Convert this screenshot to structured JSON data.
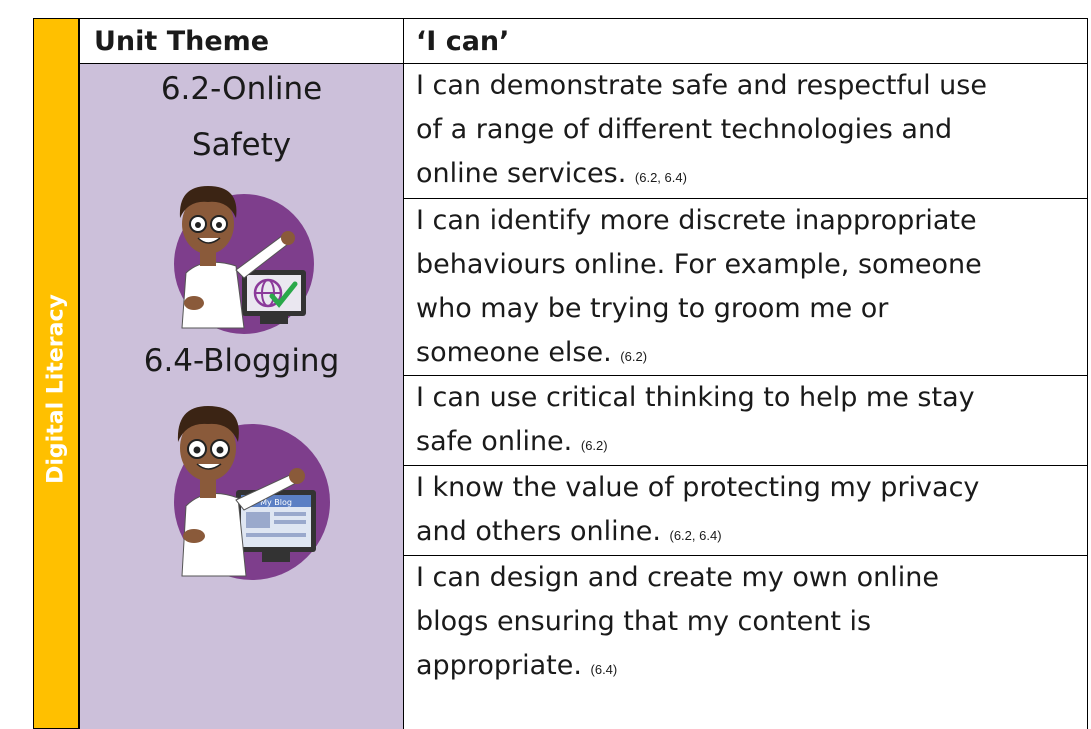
{
  "sidebar": {
    "label": "Digital Literacy",
    "color": "#ffc000"
  },
  "header": {
    "unit_theme": "Unit Theme",
    "i_can": "‘I can’"
  },
  "themes": [
    {
      "line1": "6.2-Online",
      "line2": "Safety",
      "icon": "teacher-globe-checkmark-icon"
    },
    {
      "line1": "6.4-Blogging",
      "icon": "teacher-blog-screen-icon",
      "screen_text": "My Blog"
    }
  ],
  "rows": [
    {
      "lines": [
        "I can demonstrate safe and respectful use",
        "of a range of different technologies and",
        "online services."
      ],
      "ref": "(6.2, 6.4)"
    },
    {
      "lines": [
        "I can identify more discrete inappropriate",
        "behaviours online. For example, someone",
        "who may be trying to groom me or",
        "someone else."
      ],
      "ref": "(6.2)"
    },
    {
      "lines": [
        "I can use critical thinking to help me stay",
        "safe online."
      ],
      "ref": "(6.2)"
    },
    {
      "lines": [
        "I know the value of protecting my privacy",
        "and others online."
      ],
      "ref": "(6.2, 6.4)"
    },
    {
      "lines": [
        "I can design and create my own online",
        "blogs ensuring that my content is",
        "appropriate."
      ],
      "ref": "(6.4)"
    }
  ],
  "colors": {
    "theme_bg": "#ccc0da",
    "avatar_circle": "#7e3e8c"
  }
}
